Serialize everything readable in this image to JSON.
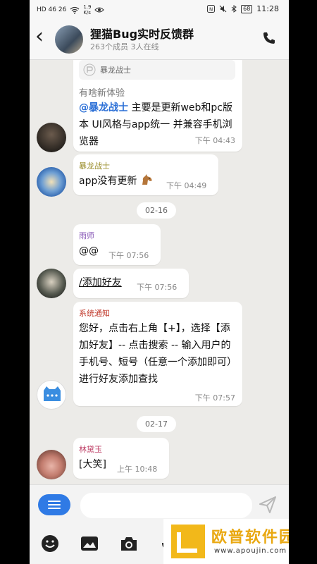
{
  "status": {
    "left_text": "HD 46 26",
    "speed": "1.9\nK/s",
    "battery": "68",
    "time": "11:28"
  },
  "header": {
    "title": "狸猫Bug实时反馈群",
    "subtitle": "263个成员  3人在线"
  },
  "messages": {
    "m1": {
      "quote_sender": "暴龙战士",
      "quote_text": "有啥新体验",
      "mention": "@暴龙战士",
      "text": " 主要是更新web和pc版本 UI风格与app统一 并兼容手机浏览器",
      "time": "下午 04:43"
    },
    "m2": {
      "sender": "暴龙战士",
      "text": "app没有更新",
      "time": "下午 04:49"
    },
    "date1": "02-16",
    "m3": {
      "sender": "雨师",
      "text": "@@",
      "time": "下午 07:56"
    },
    "m4": {
      "text": "/添加好友",
      "time": "下午 07:56"
    },
    "m5": {
      "sender": "系统通知",
      "text": "您好，点击右上角【+】，选择【添加好友】-- 点击搜索 -- 输入用户的手机号、短号（任意一个添加即可）进行好友添加查找",
      "time": "下午 07:57"
    },
    "date2": "02-17",
    "m6": {
      "sender": "林黛玉",
      "text": "[大笑]",
      "time": "上午 10:48"
    }
  },
  "input": {
    "placeholder": ""
  },
  "watermark": {
    "text": "欧普软件园",
    "url": "www.apoujin.com"
  },
  "colors": {
    "accent": "#2f7ae5",
    "sender_olive": "#9a8d2a",
    "sender_purple": "#8a5bb8",
    "sender_red": "#c0392b",
    "sender_pink": "#c0446a"
  }
}
